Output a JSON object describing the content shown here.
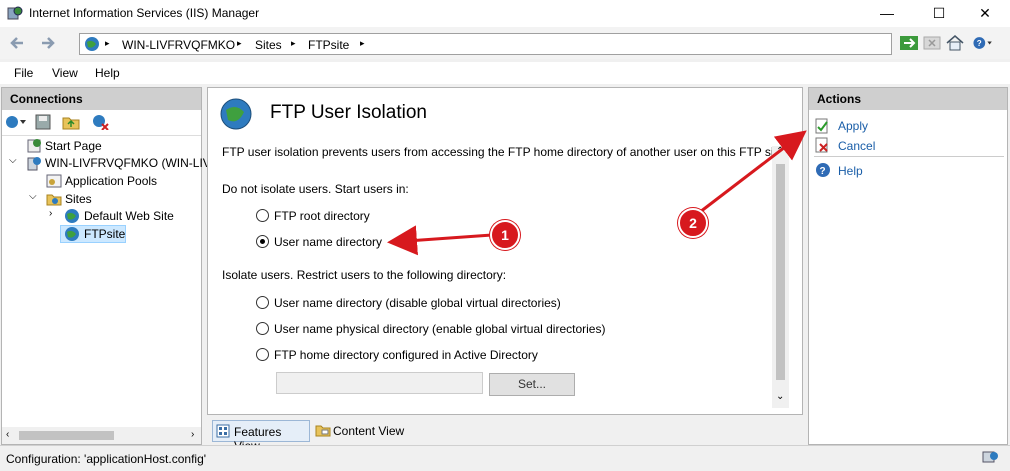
{
  "window": {
    "title": "Internet Information Services (IIS) Manager",
    "controls": {
      "minimize": "—",
      "maximize": "☐",
      "close": "✕"
    }
  },
  "address": {
    "segments": [
      "WIN-LIVFRVQFMKO",
      "Sites",
      "FTPsite"
    ],
    "separator": "▸"
  },
  "menu": [
    "File",
    "View",
    "Help"
  ],
  "connections": {
    "header": "Connections",
    "tree": [
      {
        "label": "Start Page",
        "icon": "start-page-icon"
      },
      {
        "label": "WIN-LIVFRVQFMKO (WIN-LIV",
        "icon": "server-icon"
      },
      {
        "label": "Application Pools",
        "icon": "app-pools-icon"
      },
      {
        "label": "Sites",
        "icon": "sites-folder-icon"
      },
      {
        "label": "Default Web Site",
        "icon": "globe-icon"
      },
      {
        "label": "FTPsite",
        "icon": "globe-icon"
      }
    ]
  },
  "feature": {
    "title": "FTP User Isolation",
    "description": "FTP user isolation prevents users from accessing the FTP home directory of another user on this FTP site.",
    "group1_label": "Do not isolate users. Start users in:",
    "group1_options": [
      "FTP root directory",
      "User name directory"
    ],
    "group2_label": "Isolate users. Restrict users to the following directory:",
    "group2_options": [
      "User name directory (disable global virtual directories)",
      "User name physical directory (enable global virtual directories)",
      "FTP home directory configured in Active Directory"
    ],
    "set_button": "Set...",
    "ad_field_value": ""
  },
  "view_tabs": [
    "Features View",
    "Content View"
  ],
  "actions": {
    "header": "Actions",
    "items": [
      "Apply",
      "Cancel",
      "Help"
    ]
  },
  "status": {
    "text": "Configuration: 'applicationHost.config'"
  },
  "callouts": [
    "1",
    "2"
  ],
  "colors": {
    "accent": "#d7191e",
    "link": "#1a5ea8",
    "header_bg": "#cfcfcf",
    "selected_bg": "#cce8ff"
  }
}
